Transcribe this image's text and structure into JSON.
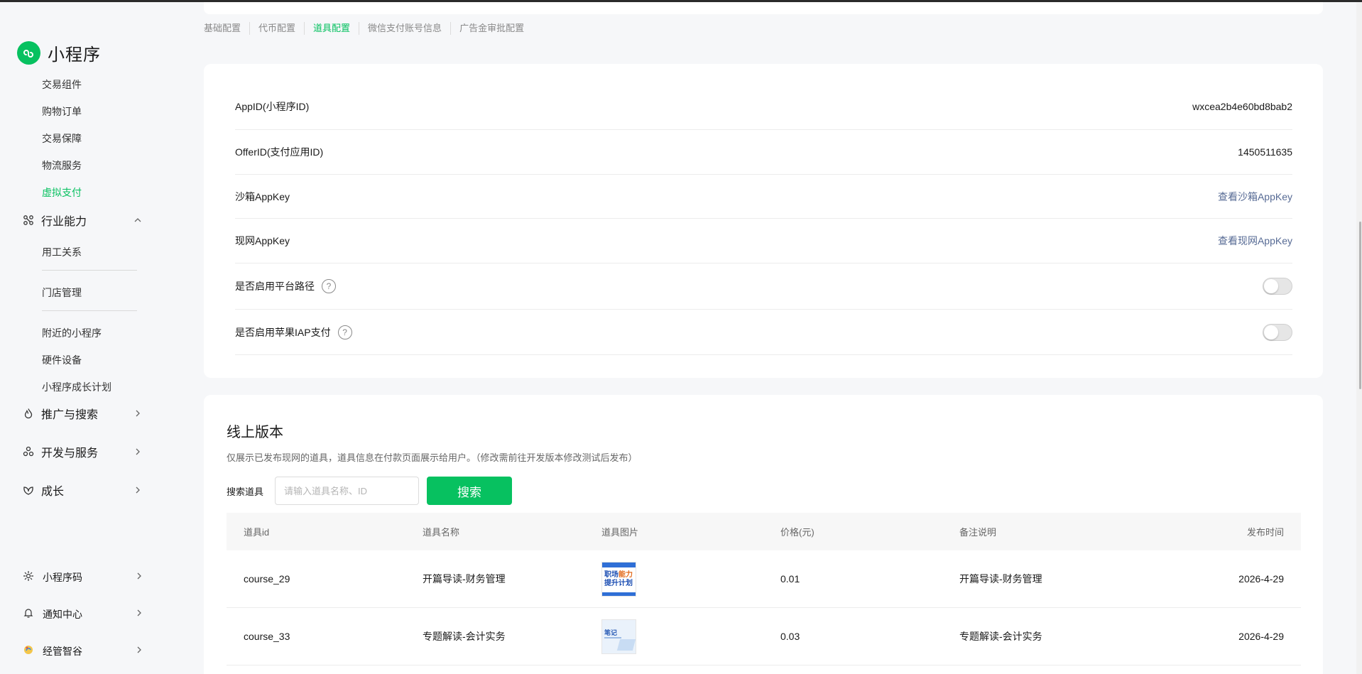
{
  "sidebar": {
    "brand": "小程序",
    "sub_items_top": [
      "交易组件",
      "购物订单",
      "交易保障",
      "物流服务",
      "虚拟支付"
    ],
    "industry": {
      "label": "行业能力",
      "items_a": [
        "用工关系"
      ],
      "items_b": [
        "门店管理"
      ],
      "items_c": [
        "附近的小程序",
        "硬件设备",
        "小程序成长计划"
      ]
    },
    "groups": [
      "推广与搜索",
      "开发与服务",
      "成长"
    ],
    "bottom": [
      "小程序码",
      "通知中心",
      "经管智谷"
    ]
  },
  "tabs": [
    {
      "label": "基础配置",
      "active": false
    },
    {
      "label": "代币配置",
      "active": false
    },
    {
      "label": "道具配置",
      "active": true
    },
    {
      "label": "微信支付账号信息",
      "active": false
    },
    {
      "label": "广告金审批配置",
      "active": false
    }
  ],
  "config": {
    "appid_label": "AppID(小程序ID)",
    "appid_value": "wxcea2b4e60bd8bab2",
    "offerid_label": "OfferID(支付应用ID)",
    "offerid_value": "1450511635",
    "sandbox_label": "沙箱AppKey",
    "sandbox_link": "查看沙箱AppKey",
    "live_label": "现网AppKey",
    "live_link": "查看现网AppKey",
    "platform_path_label": "是否启用平台路径",
    "platform_path_enabled": false,
    "apple_iap_label": "是否启用苹果IAP支付",
    "apple_iap_enabled": false,
    "help_glyph": "?"
  },
  "online": {
    "title": "线上版本",
    "desc": "仅展示已发布现网的道具，道具信息在付款页面展示给用户。（修改需前往开发版本修改测试后发布）",
    "search_label": "搜索道具",
    "search_placeholder": "请输入道具名称、ID",
    "search_button": "搜索",
    "columns": [
      "道具id",
      "道具名称",
      "道具图片",
      "价格(元)",
      "备注说明",
      "发布时间"
    ],
    "rows": [
      {
        "id": "course_29",
        "name": "开篇导读-财务管理",
        "price": "0.01",
        "note": "开篇导读-财务管理",
        "date": "2026-4-29",
        "thumb_line1": "职场",
        "thumb_line1b": "能力",
        "thumb_line2": "提升计划"
      },
      {
        "id": "course_33",
        "name": "专题解读-会计实务",
        "price": "0.03",
        "note": "专题解读-会计实务",
        "date": "2026-4-29",
        "thumb_line1": "笔记"
      }
    ]
  },
  "colors": {
    "accent": "#07c160",
    "link": "#576b95",
    "background": "#f6f7f9"
  }
}
